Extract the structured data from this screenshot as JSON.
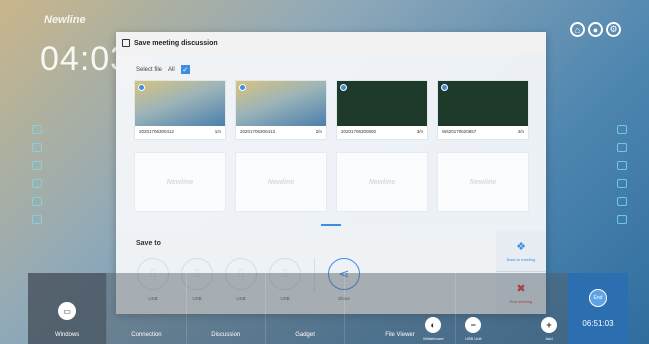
{
  "desktop": {
    "brand": "Newline",
    "clock": "04:03"
  },
  "dialog": {
    "title": "Save meeting discussion",
    "select_label": "Select file",
    "all_label": "All",
    "thumbnails": [
      {
        "kind": "desktop",
        "name": "20201706300412",
        "page": "1/n"
      },
      {
        "kind": "desktop",
        "name": "20201706300413",
        "page": "2/n"
      },
      {
        "kind": "board",
        "name": "20201706300600",
        "page": "3/n"
      },
      {
        "kind": "board",
        "name": "W620170620657",
        "page": "4/n"
      }
    ],
    "empty_slot_label": "Newline",
    "save_to_label": "Save to",
    "destinations": [
      {
        "label": "USB"
      },
      {
        "label": "USB"
      },
      {
        "label": "USB"
      },
      {
        "label": "USB"
      }
    ],
    "share_label": "Share",
    "back_label": "Back to meeting",
    "end_label": "End meeting"
  },
  "taskbar": {
    "items": [
      "Windows",
      "Connection",
      "Discussion",
      "Gadget",
      "File Viewer"
    ],
    "extras": [
      "Whiteboard",
      "USB Unit",
      "Add"
    ],
    "end_button": "End",
    "time": "06:51:03"
  },
  "colors": {
    "accent": "#3e8ee0",
    "danger": "#e03030",
    "taskbar_end": "#2b6fb1"
  }
}
